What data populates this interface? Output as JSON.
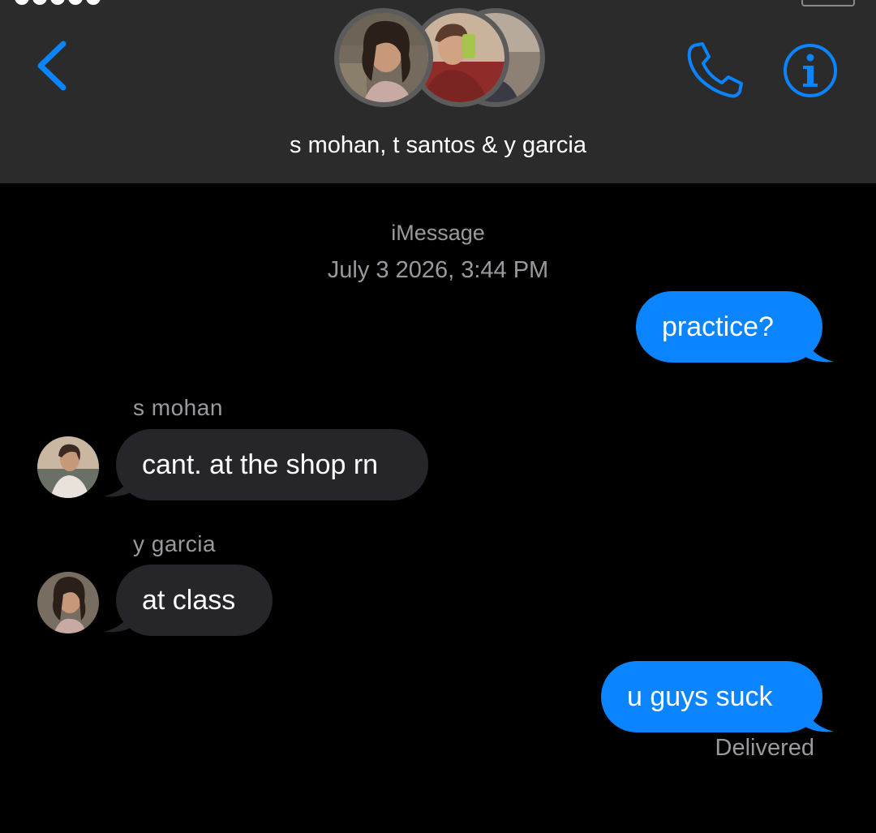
{
  "conversation": {
    "title": "s mohan, t santos & y garcia"
  },
  "thread": {
    "service": "iMessage",
    "timestamp": "July 3 2026, 3:44 PM",
    "messages": [
      {
        "direction": "outgoing",
        "text": "practice?"
      },
      {
        "direction": "incoming",
        "sender": "s mohan",
        "text": "cant. at the shop rn"
      },
      {
        "direction": "incoming",
        "sender": "y garcia",
        "text": "at class"
      },
      {
        "direction": "outgoing",
        "text": "u guys suck"
      }
    ],
    "status": "Delivered"
  },
  "icons": {
    "back": "chevron-left-icon",
    "call": "phone-icon",
    "info": "info-icon"
  },
  "colors": {
    "accent": "#0a84ff",
    "header_bg": "#2b2b2b",
    "incoming_bubble": "#26252a",
    "meta_text": "#9a9a9e"
  }
}
